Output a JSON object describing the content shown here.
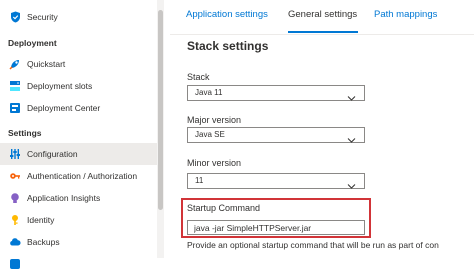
{
  "sidebar": {
    "items": [
      {
        "label": "Security"
      },
      {
        "label": "Quickstart"
      },
      {
        "label": "Deployment slots"
      },
      {
        "label": "Deployment Center"
      },
      {
        "label": "Configuration"
      },
      {
        "label": "Authentication / Authorization"
      },
      {
        "label": "Application Insights"
      },
      {
        "label": "Identity"
      },
      {
        "label": "Backups"
      }
    ],
    "sections": {
      "deployment": "Deployment",
      "settings": "Settings"
    },
    "selected": "Configuration"
  },
  "tabs": [
    {
      "label": "Application settings"
    },
    {
      "label": "General settings"
    },
    {
      "label": "Path mappings"
    }
  ],
  "stack_settings": {
    "title": "Stack settings",
    "stack": {
      "label": "Stack",
      "value": "Java 11"
    },
    "major_version": {
      "label": "Major version",
      "value": "Java SE"
    },
    "minor_version": {
      "label": "Minor version",
      "value": "11"
    },
    "startup_command": {
      "label": "Startup Command",
      "value": "java -jar SimpleHTTPServer.jar",
      "helper": "Provide an optional startup command that will be run as part of con"
    }
  },
  "colors": {
    "accent": "#0078d4",
    "highlight": "#d13438",
    "selected_bg": "#edebe9"
  }
}
